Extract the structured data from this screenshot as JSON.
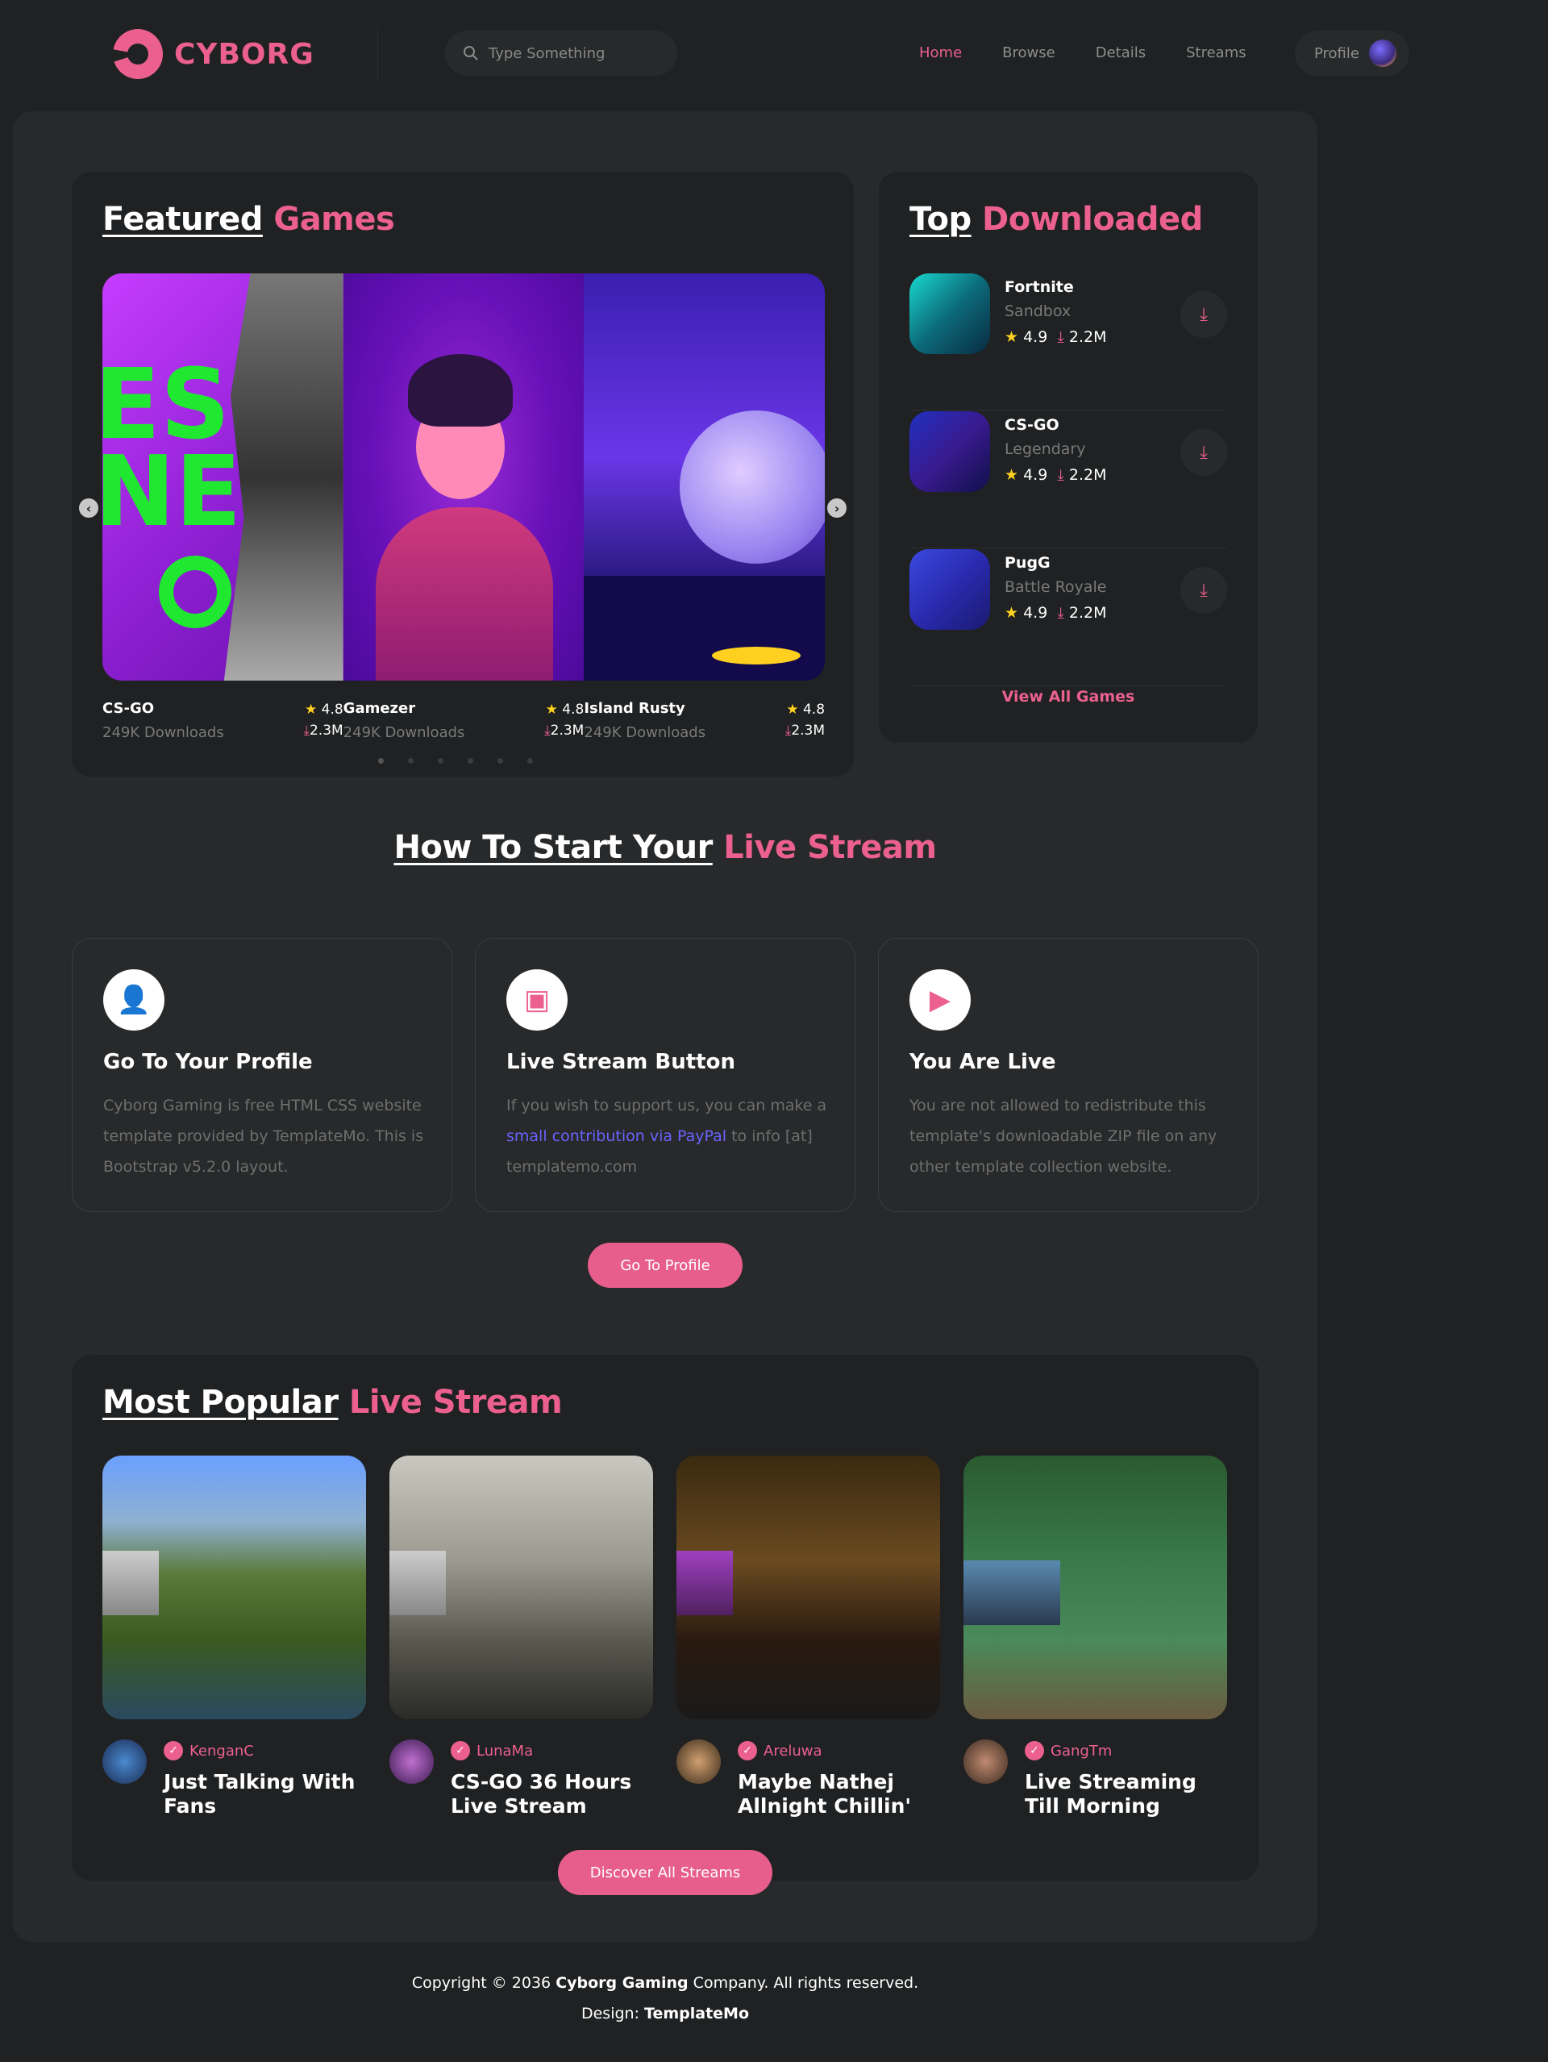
{
  "brand": {
    "name": "CYBORG"
  },
  "search": {
    "placeholder": "Type Something"
  },
  "nav": {
    "items": [
      "Home",
      "Browse",
      "Details",
      "Streams"
    ],
    "profile": "Profile"
  },
  "featured": {
    "title_a": "Featured",
    "title_b": "Games",
    "games": [
      {
        "name": "CS-GO",
        "downloads": "249K Downloads",
        "rating": "4.8",
        "count": "2.3M"
      },
      {
        "name": "Gamezer",
        "downloads": "249K Downloads",
        "rating": "4.8",
        "count": "2.3M"
      },
      {
        "name": "Island Rusty",
        "downloads": "249K Downloads",
        "rating": "4.8",
        "count": "2.3M"
      }
    ]
  },
  "top_downloaded": {
    "title_a": "Top",
    "title_b": "Downloaded",
    "items": [
      {
        "name": "Fortnite",
        "category": "Sandbox",
        "rating": "4.9",
        "count": "2.2M"
      },
      {
        "name": "CS-GO",
        "category": "Legendary",
        "rating": "4.9",
        "count": "2.2M"
      },
      {
        "name": "PugG",
        "category": "Battle Royale",
        "rating": "4.9",
        "count": "2.2M"
      }
    ],
    "view_all": "View All Games"
  },
  "howto": {
    "title_a": "How To Start Your",
    "title_b": "Live Stream",
    "steps": [
      {
        "title": "Go To Your Profile",
        "text": "Cyborg Gaming is free HTML CSS website template provided by TemplateMo. This is Bootstrap v5.2.0 layout."
      },
      {
        "title": "Live Stream Button",
        "text_a": "If you wish to support us, you can make a",
        "link": "small contribution via PayPal",
        "text_b": "to info [at] templatemo.com"
      },
      {
        "title": "You Are Live",
        "text": "You are not allowed to redistribute this template's downloadable ZIP file on any other template collection website."
      }
    ],
    "button": "Go To Profile"
  },
  "popular": {
    "title_a": "Most Popular",
    "title_b": "Live Stream",
    "streams": [
      {
        "user": "KenganC",
        "title": "Just Talking With Fans"
      },
      {
        "user": "LunaMa",
        "title": "CS-GO 36 Hours Live Stream"
      },
      {
        "user": "Areluwa",
        "title": "Maybe Nathej Allnight Chillin'"
      },
      {
        "user": "GangTm",
        "title": "Live Streaming Till Morning"
      }
    ],
    "button": "Discover All Streams"
  },
  "footer": {
    "copyright_a": "Copyright © 2036",
    "company": "Cyborg Gaming",
    "copyright_b": "Company. All rights reserved.",
    "design_label": "Design:",
    "designer": "TemplateMo"
  },
  "colors": {
    "accent": "#ec6090",
    "background": "#1f2122",
    "panel": "#27292a",
    "link": "#6b63ff"
  }
}
